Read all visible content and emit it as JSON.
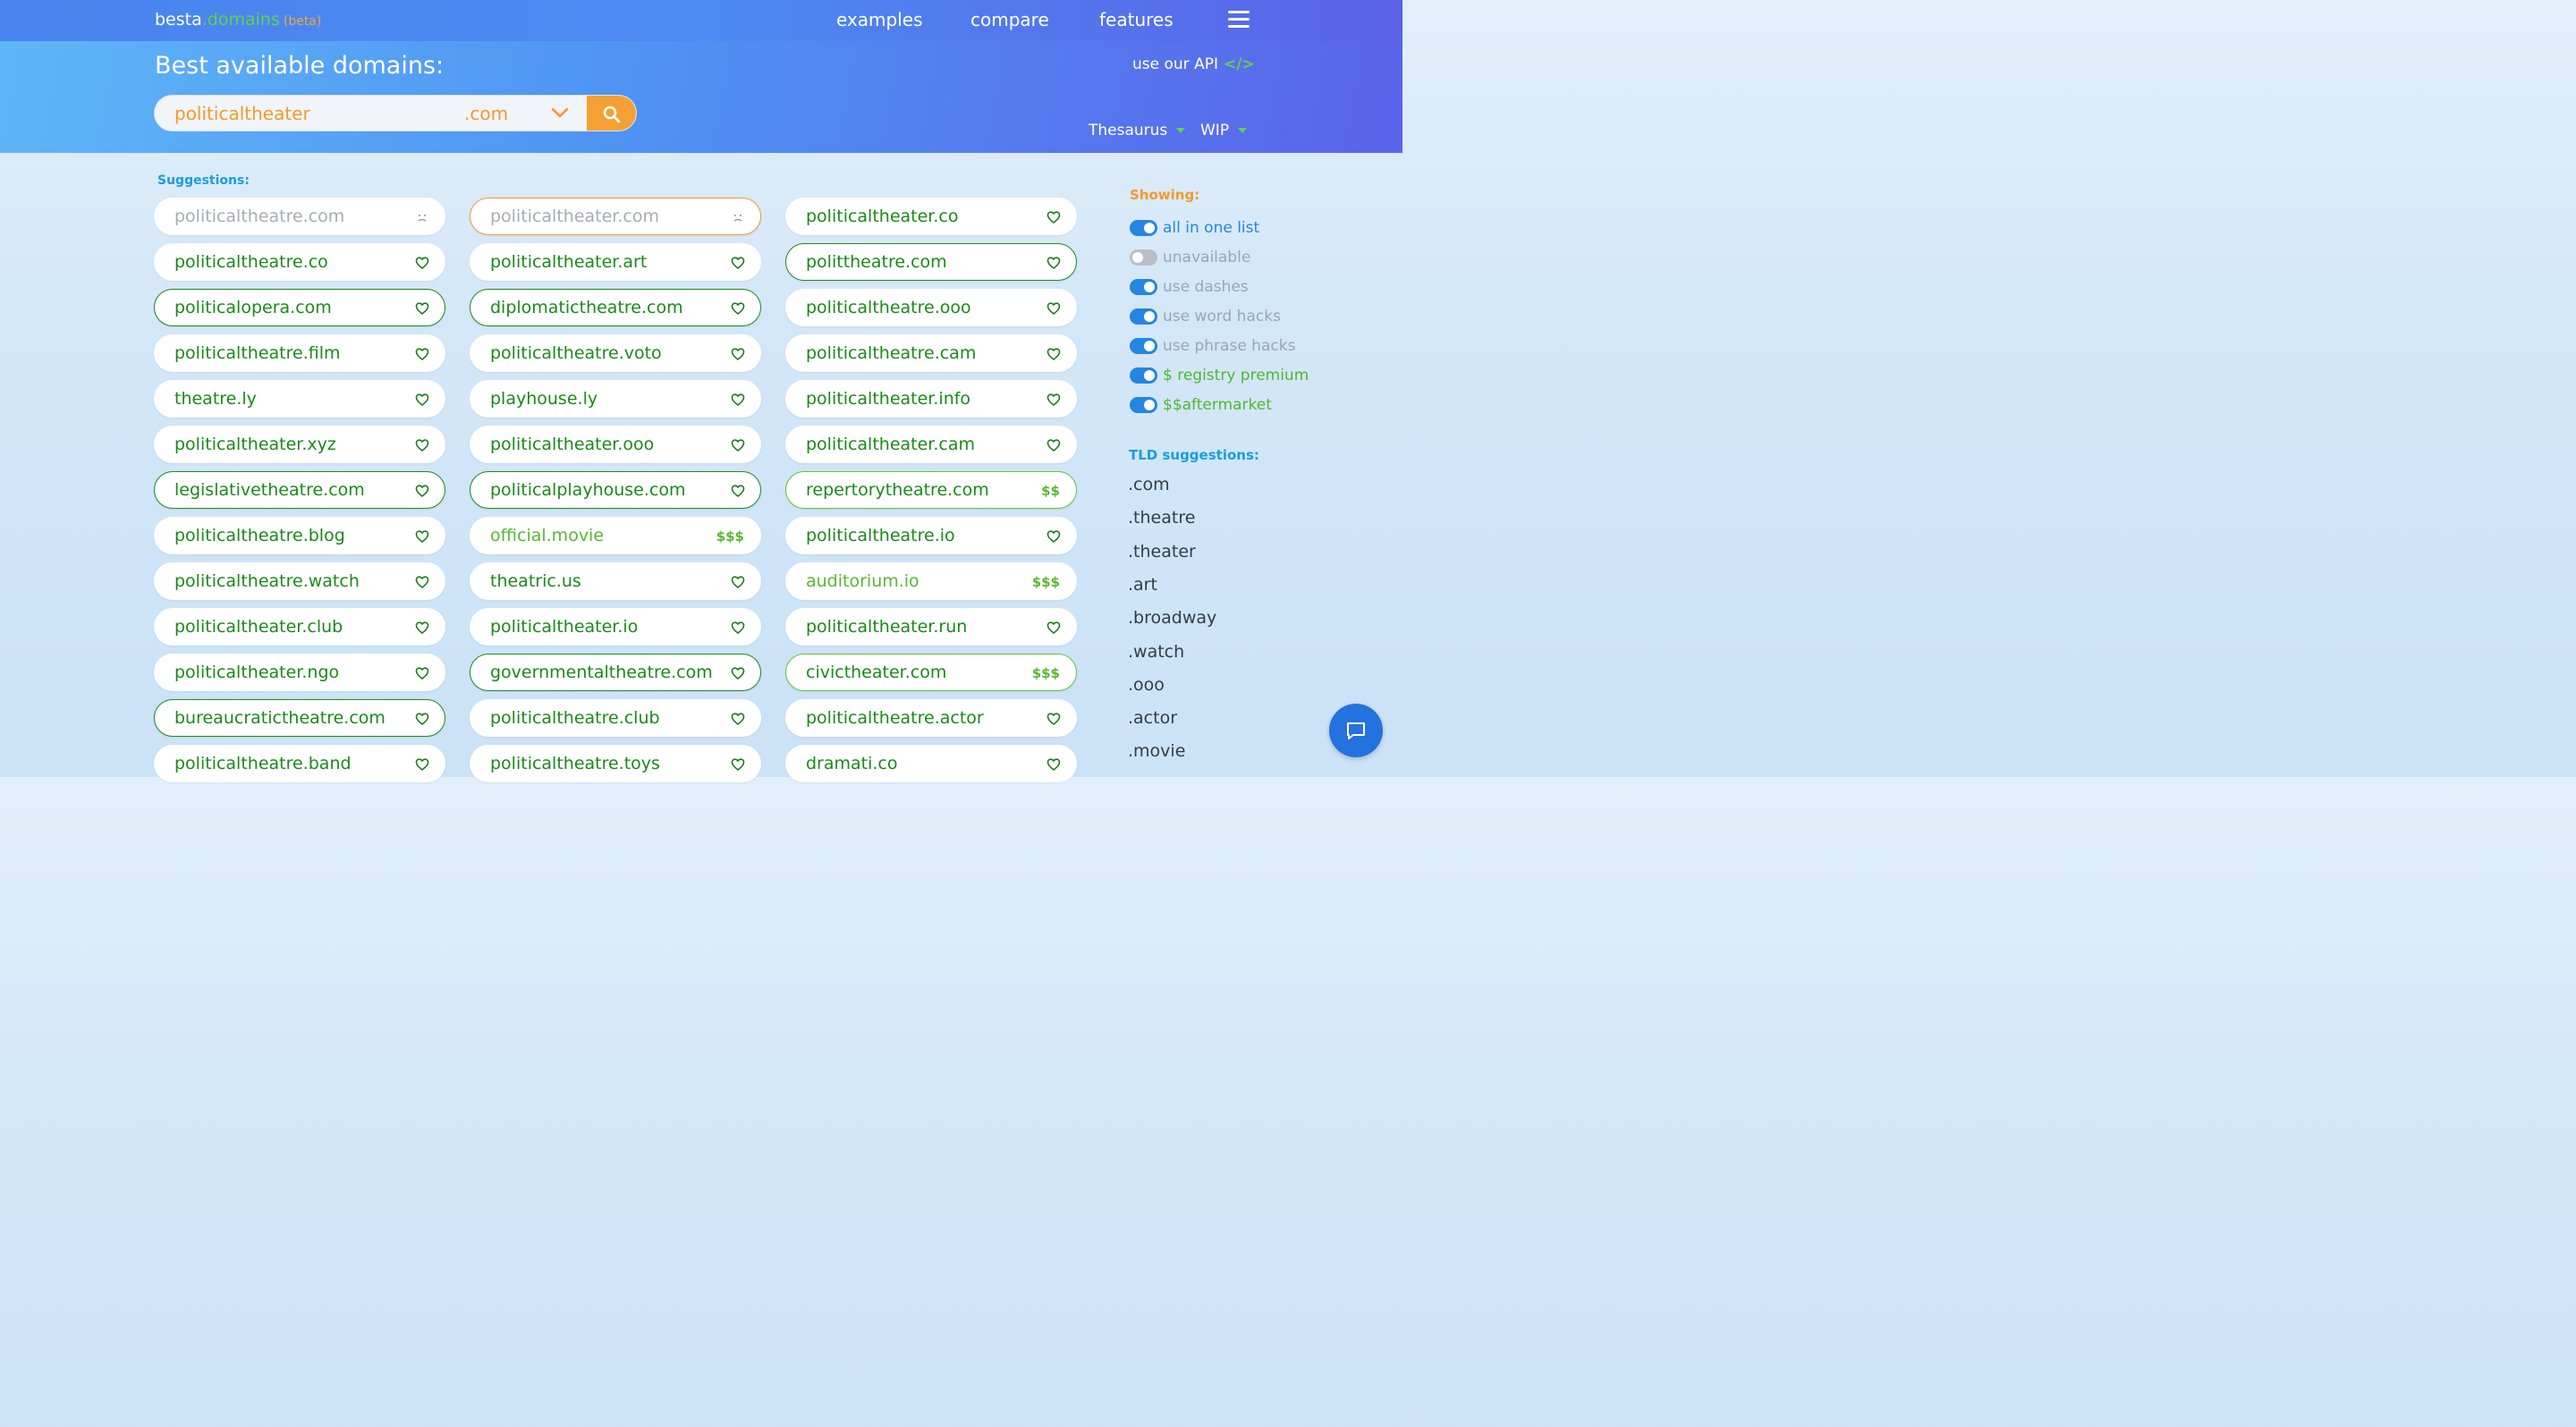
{
  "header": {
    "logo_main": "besta",
    "logo_domains": ".domains",
    "logo_beta": "(beta)",
    "nav": [
      "examples",
      "compare",
      "features"
    ],
    "headline": "Best available domains:",
    "api_link": "use our API",
    "api_icon": "</>",
    "search_value": "politicaltheater",
    "search_tld": ".com",
    "filter_1": "Thesaurus",
    "filter_2": "WIP"
  },
  "suggestions_label": "Suggestions:",
  "columns": [
    [
      {
        "name": "politicaltheatre.com",
        "state": "taken",
        "mark": "sad"
      },
      {
        "name": "politicaltheatre.co",
        "state": "normal",
        "mark": "heart"
      },
      {
        "name": "politicalopera.com",
        "state": "outlined",
        "mark": "heart"
      },
      {
        "name": "politicaltheatre.film",
        "state": "normal",
        "mark": "heart"
      },
      {
        "name": "theatre.ly",
        "state": "normal",
        "mark": "heart"
      },
      {
        "name": "politicaltheater.xyz",
        "state": "normal",
        "mark": "heart"
      },
      {
        "name": "legislativetheatre.com",
        "state": "outlined",
        "mark": "heart"
      },
      {
        "name": "politicaltheatre.blog",
        "state": "normal",
        "mark": "heart"
      },
      {
        "name": "politicaltheatre.watch",
        "state": "normal",
        "mark": "heart"
      },
      {
        "name": "politicaltheater.club",
        "state": "normal",
        "mark": "heart"
      },
      {
        "name": "politicaltheater.ngo",
        "state": "normal",
        "mark": "heart"
      },
      {
        "name": "bureaucratictheatre.com",
        "state": "outlined",
        "mark": "heart"
      },
      {
        "name": "politicaltheatre.band",
        "state": "normal",
        "mark": "heart"
      }
    ],
    [
      {
        "name": "politicaltheater.com",
        "state": "taken-orange",
        "mark": "sad"
      },
      {
        "name": "politicaltheater.art",
        "state": "normal",
        "mark": "heart"
      },
      {
        "name": "diplomatictheatre.com",
        "state": "outlined",
        "mark": "heart"
      },
      {
        "name": "politicaltheatre.voto",
        "state": "normal",
        "mark": "heart"
      },
      {
        "name": "playhouse.ly",
        "state": "normal",
        "mark": "heart"
      },
      {
        "name": "politicaltheater.ooo",
        "state": "normal",
        "mark": "heart"
      },
      {
        "name": "politicalplayhouse.com",
        "state": "outlined",
        "mark": "heart"
      },
      {
        "name": "official.movie",
        "state": "lightgreen",
        "mark": "$$$"
      },
      {
        "name": "theatric.us",
        "state": "normal",
        "mark": "heart"
      },
      {
        "name": "politicaltheater.io",
        "state": "normal",
        "mark": "heart"
      },
      {
        "name": "governmentaltheatre.com",
        "state": "outlined",
        "mark": "heart"
      },
      {
        "name": "politicaltheatre.club",
        "state": "normal",
        "mark": "heart"
      },
      {
        "name": "politicaltheatre.toys",
        "state": "normal",
        "mark": "heart"
      }
    ],
    [
      {
        "name": "politicaltheater.co",
        "state": "normal",
        "mark": "heart"
      },
      {
        "name": "polittheatre.com",
        "state": "outlined",
        "mark": "heart"
      },
      {
        "name": "politicaltheatre.ooo",
        "state": "normal",
        "mark": "heart"
      },
      {
        "name": "politicaltheatre.cam",
        "state": "normal",
        "mark": "heart"
      },
      {
        "name": "politicaltheater.info",
        "state": "normal",
        "mark": "heart"
      },
      {
        "name": "politicaltheater.cam",
        "state": "normal",
        "mark": "heart"
      },
      {
        "name": "repertorytheatre.com",
        "state": "premium",
        "mark": "$$"
      },
      {
        "name": "politicaltheatre.io",
        "state": "normal",
        "mark": "heart"
      },
      {
        "name": "auditorium.io",
        "state": "lightgreen",
        "mark": "$$$"
      },
      {
        "name": "politicaltheater.run",
        "state": "normal",
        "mark": "heart"
      },
      {
        "name": "civictheater.com",
        "state": "premium",
        "mark": "$$$"
      },
      {
        "name": "politicaltheatre.actor",
        "state": "normal",
        "mark": "heart"
      },
      {
        "name": "dramati.co",
        "state": "normal",
        "mark": "heart"
      }
    ]
  ],
  "sidebar": {
    "showing_label": "Showing:",
    "toggles": [
      {
        "label": "all in one list",
        "on": true,
        "color": "blue"
      },
      {
        "label": "unavailable",
        "on": false,
        "color": "grey"
      },
      {
        "label": "use dashes",
        "on": true,
        "color": "grey"
      },
      {
        "label": "use word hacks",
        "on": true,
        "color": "grey"
      },
      {
        "label": "use phrase hacks",
        "on": true,
        "color": "grey"
      },
      {
        "label": "$ registry premium",
        "on": true,
        "color": "green"
      },
      {
        "label": "$$aftermarket",
        "on": true,
        "color": "green"
      }
    ],
    "tld_label": "TLD suggestions:",
    "tlds": [
      ".com",
      ".theatre",
      ".theater",
      ".art",
      ".broadway",
      ".watch",
      ".ooo",
      ".actor",
      ".movie"
    ]
  },
  "colors": {
    "brand_green": "#1a8a1a",
    "accent_orange": "#f29a2e",
    "accent_blue": "#2486e0"
  }
}
